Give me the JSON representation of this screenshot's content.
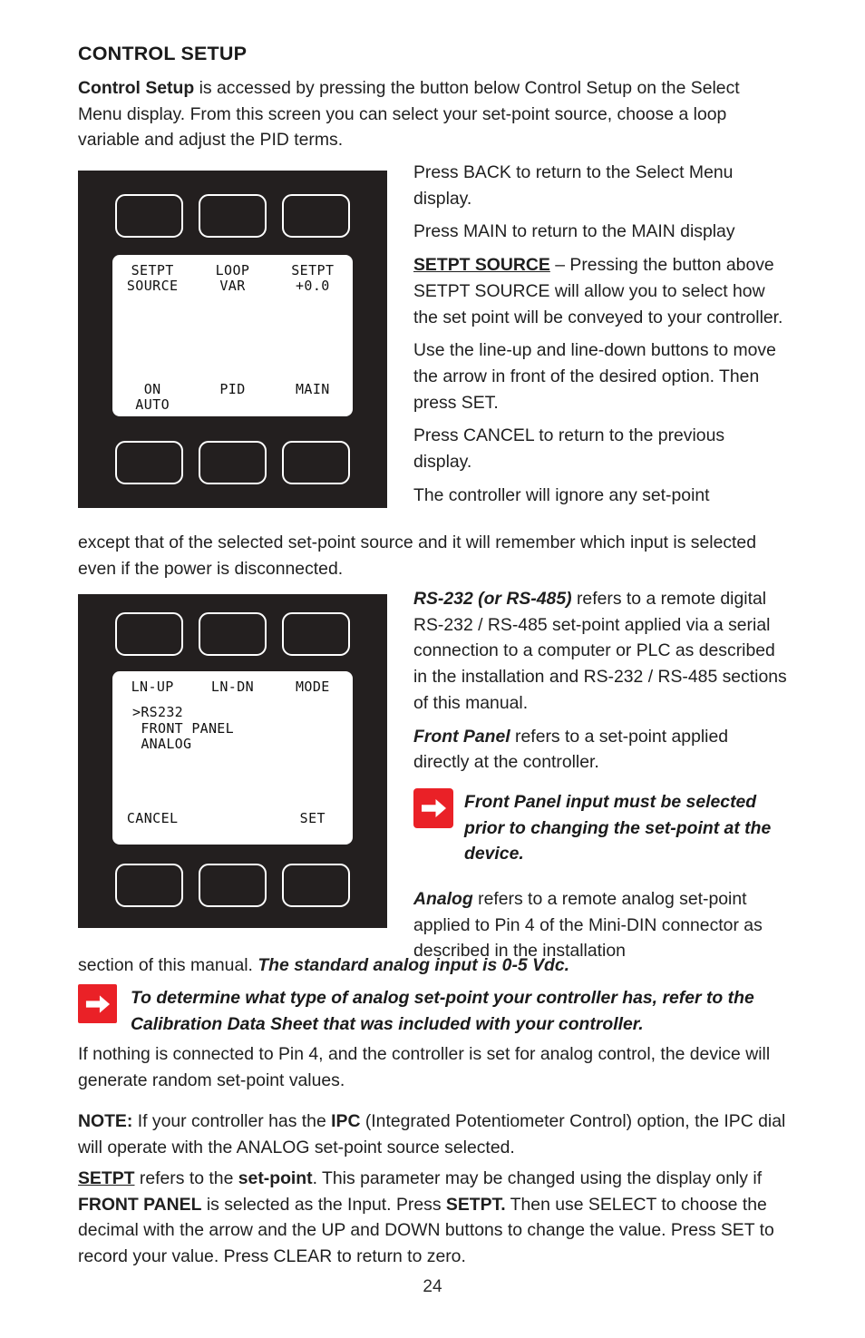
{
  "document": {
    "heading": "CONTROL SETUP",
    "page_number": "24"
  },
  "intro": {
    "bold_lead": "Control Setup",
    "rest": " is accessed by pressing the button below Control Setup on the Select Menu display. From this screen you can select your set-point source, choose a loop variable and adjust the PID terms."
  },
  "column_right_1": {
    "p1": "Press BACK to return to the Select Menu display.",
    "p2": "Press MAIN to return to the MAIN display",
    "p3_term": "SETPT SOURCE",
    "p3_rest": " – Pressing the button above SETPT SOURCE will allow you to select how the set point will be conveyed to your controller.",
    "p4": "Use the line-up and line-down buttons to move the arrow in front of the desired option. Then press SET.",
    "p5": "Press CANCEL to return to the previous display.",
    "p6": "The controller will ignore any set-point"
  },
  "full_1": {
    "text": "except that of the selected set-point source and it will remember which input is selected even if the power is disconnected."
  },
  "column_right_2": {
    "p1_term": "RS-232 (or RS-485)",
    "p1_rest": " refers to a remote digital RS-232 / RS-485 set-point applied via a serial connection to a computer or PLC as described in the installation and RS-232 / RS-485 sections of this manual.",
    "p2_term": "Front Panel",
    "p2_rest": " refers to a set-point applied directly at the controller."
  },
  "callout_1": {
    "icon": "arrow-right-icon",
    "color": "#ea2127",
    "text": "Front Panel input must be selected prior to changing the set-point at the device."
  },
  "analog_para": {
    "term": "Analog",
    "rest": " refers to a remote analog set-point applied to Pin 4 of the Mini-DIN connector as described in the installation"
  },
  "full_2": {
    "plain": "section of this manual. ",
    "bold_italic": "The standard analog input is 0-5 Vdc."
  },
  "callout_2": {
    "icon": "arrow-right-icon",
    "color": "#ea2127",
    "text": "To determine what type of analog set-point your controller has, refer to the Calibration Data Sheet that was included with your controller."
  },
  "full_3": {
    "text": "If nothing is connected to Pin 4, and the controller is set for analog control, the device will generate random set-point values."
  },
  "full_4": {
    "note_label": "NOTE:",
    "seg_a": " If your controller has the ",
    "ipc": "IPC",
    "seg_b": " (Integrated Potentiometer Control) option, the IPC dial will operate with the ANALOG set-point source selected."
  },
  "full_5": {
    "setpt": "SETPT",
    "seg_a": " refers to the ",
    "setpoint": "set-point",
    "seg_b": ". This parameter may be changed using the display only if ",
    "front_panel": "FRONT PANEL",
    "seg_c": " is selected as the Input. Press ",
    "setpt_cmd": "SETPT.",
    "seg_d": " Then use SELECT to choose the decimal with the arrow and the UP and DOWN buttons to change the value. Press SET to record your value. Press CLEAR to return to zero."
  },
  "device_1": {
    "name": "control-setup-display",
    "panel_color": "#231f1f",
    "lcd_color": "#ffffff",
    "top_buttons": [
      "",
      "",
      ""
    ],
    "bottom_buttons": [
      "",
      "",
      ""
    ],
    "lcd_top_labels": [
      "SETPT\nSOURCE",
      "LOOP\nVAR",
      "SETPT\n+0.0"
    ],
    "lcd_bottom_labels": [
      "ON\nAUTO",
      "PID",
      "MAIN"
    ]
  },
  "device_2": {
    "name": "setpt-source-select-display",
    "panel_color": "#231f1f",
    "lcd_color": "#ffffff",
    "top_buttons": [
      "",
      "",
      ""
    ],
    "bottom_buttons": [
      "",
      "",
      ""
    ],
    "lcd_top_labels": [
      "LN-UP",
      "LN-DN",
      "MODE"
    ],
    "lcd_options": ">RS232\n FRONT PANEL\n ANALOG",
    "lcd_bottom_labels": [
      "CANCEL",
      "",
      "SET"
    ]
  }
}
